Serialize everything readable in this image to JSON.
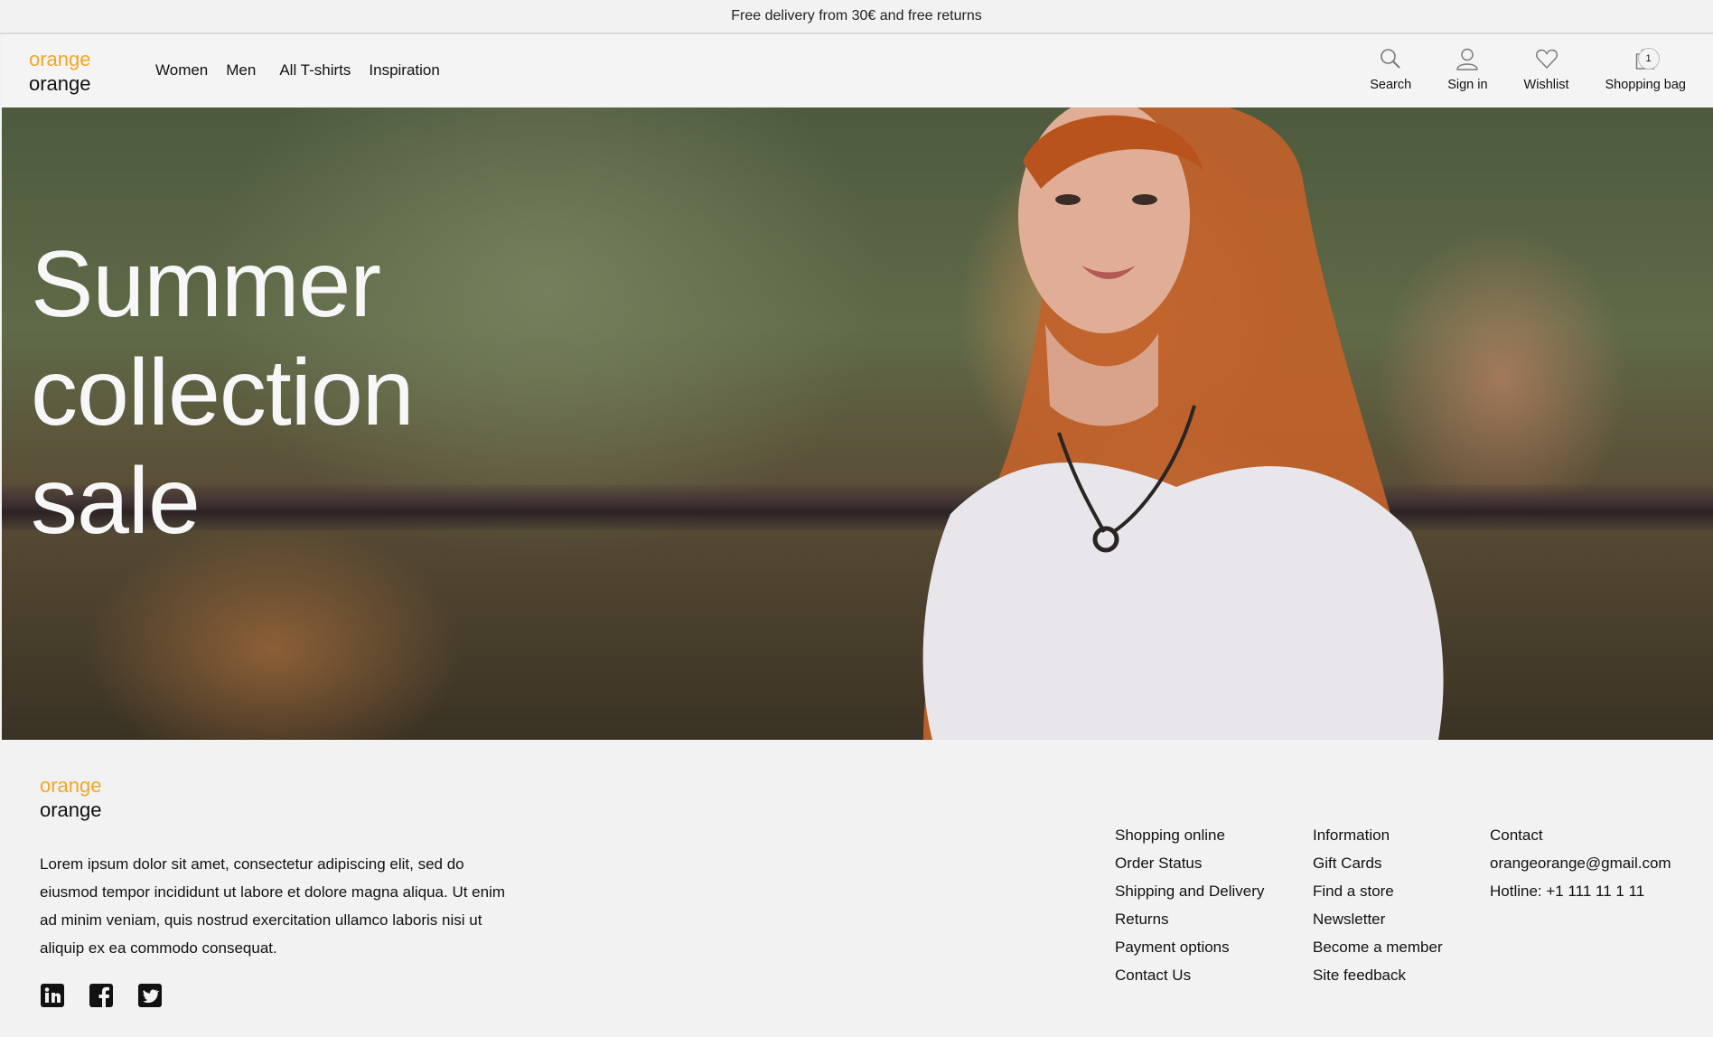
{
  "topbar": {
    "text": "Free delivery from 30€ and free returns"
  },
  "brand": {
    "line1": "orange",
    "line2": "orange",
    "accent_color": "#f5a623"
  },
  "nav": {
    "items": [
      "Women",
      "Men",
      "All T-shirts",
      "Inspiration"
    ]
  },
  "actions": {
    "search": "Search",
    "signin": "Sign in",
    "wishlist": "Wishlist",
    "bag": "Shopping bag",
    "bag_count": "1"
  },
  "hero": {
    "title": "Summer\ncollection\nsale"
  },
  "footer": {
    "about": "Lorem ipsum dolor sit amet, consectetur adipiscing elit, sed do eiusmod tempor incididunt ut labore et dolore magna aliqua. Ut enim ad minim veniam, quis nostrud exercitation ullamco laboris nisi ut aliquip ex ea commodo consequat.",
    "social": [
      "linkedin-icon",
      "facebook-icon",
      "twitter-icon"
    ],
    "col1": [
      "Shopping online",
      "Order Status",
      "Shipping and Delivery",
      "Returns",
      "Payment options",
      "Contact Us"
    ],
    "col2": [
      "Information",
      "Gift Cards",
      "Find a store",
      "Newsletter",
      "Become a member",
      "Site feedback"
    ],
    "col3": [
      "Contact",
      "orangeorange@gmail.com",
      "Hotline: +1 111 11 1 11"
    ]
  }
}
